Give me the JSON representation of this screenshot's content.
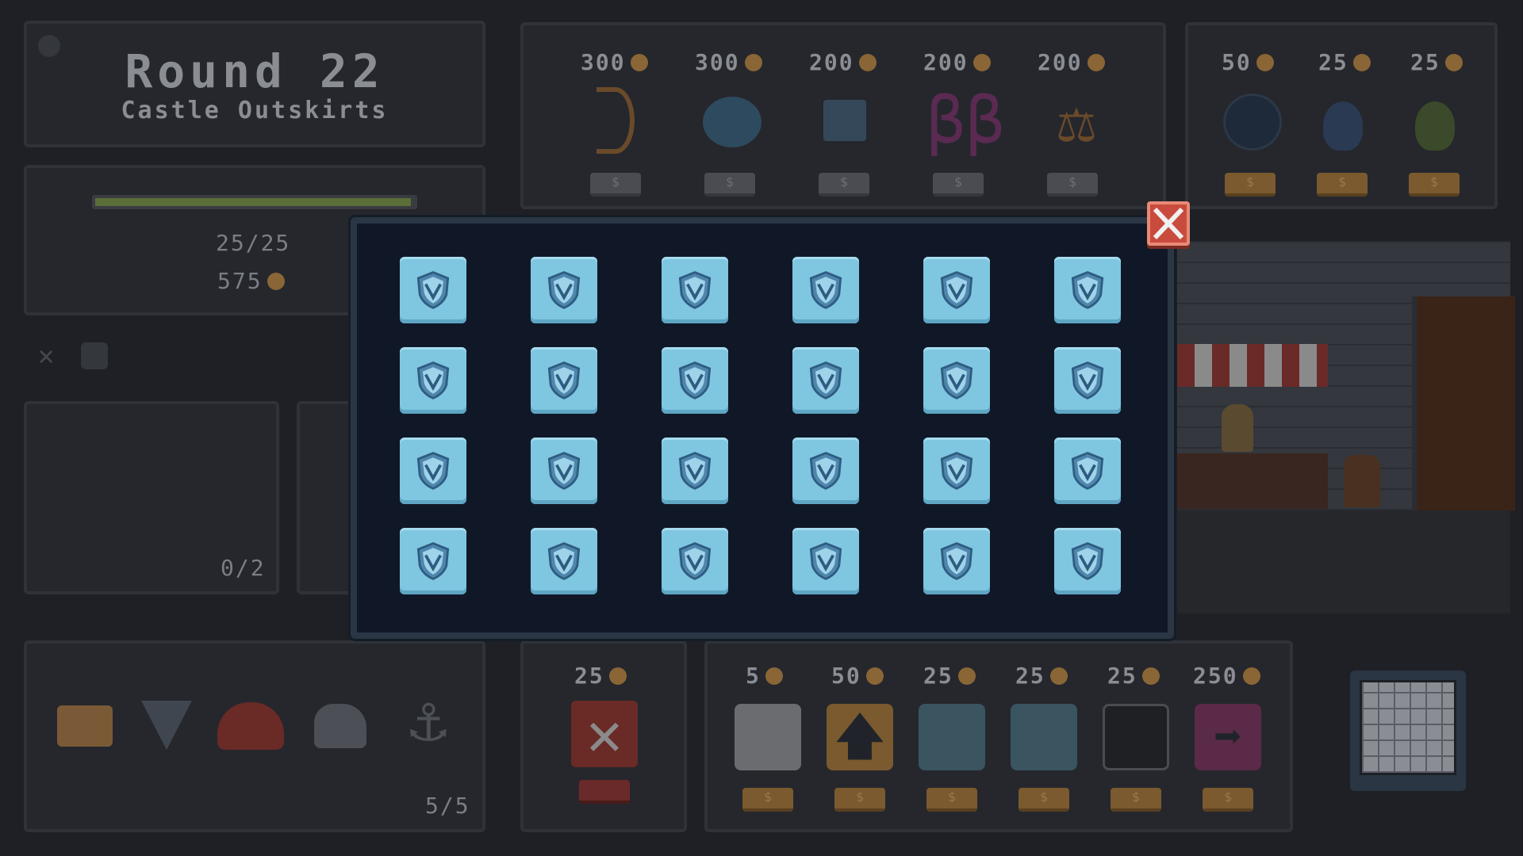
{
  "round": {
    "title": "Round 22",
    "location": "Castle Outskirts"
  },
  "stats": {
    "hp": "25/25",
    "hp_fraction": 1.0,
    "gold": "575"
  },
  "slots": {
    "count": "0/2"
  },
  "relics": {
    "count": "5/5",
    "items": [
      "camera-icon",
      "shark-tooth-icon",
      "frog-icon",
      "rock-icon",
      "anchor-icon"
    ]
  },
  "shop_top": {
    "items": [
      {
        "price": "300",
        "icon": "bow-icon"
      },
      {
        "price": "300",
        "icon": "stones-icon"
      },
      {
        "price": "200",
        "icon": "chest-icon"
      },
      {
        "price": "200",
        "icon": "beta-rune-icon"
      },
      {
        "price": "200",
        "icon": "scales-icon"
      }
    ],
    "buy_label": "$"
  },
  "shop_consumables": {
    "items": [
      {
        "price": "50",
        "icon": "orb-icon"
      },
      {
        "price": "25",
        "icon": "blue-potion-icon"
      },
      {
        "price": "25",
        "icon": "green-potion-icon"
      }
    ],
    "buy_label": "$"
  },
  "shop_remove": {
    "price": "25",
    "icon": "remove-dice-icon"
  },
  "shop_dice": {
    "items": [
      {
        "price": "5",
        "icon": "grey-dice-icon"
      },
      {
        "price": "50",
        "icon": "upgrade-arrow-icon"
      },
      {
        "price": "25",
        "icon": "shield-dice-icon"
      },
      {
        "price": "25",
        "icon": "shield-dice-icon"
      },
      {
        "price": "25",
        "icon": "black-dice-icon"
      },
      {
        "price": "250",
        "icon": "next-arrow-icon"
      }
    ],
    "buy_label": "$"
  },
  "modal": {
    "tiles": 24,
    "tile_icon": "shield-dice-icon",
    "close_icon": "close-icon"
  },
  "colors": {
    "tile": "#7fc6e0",
    "close": "#c94b3d",
    "modal_bg": "#101828"
  }
}
